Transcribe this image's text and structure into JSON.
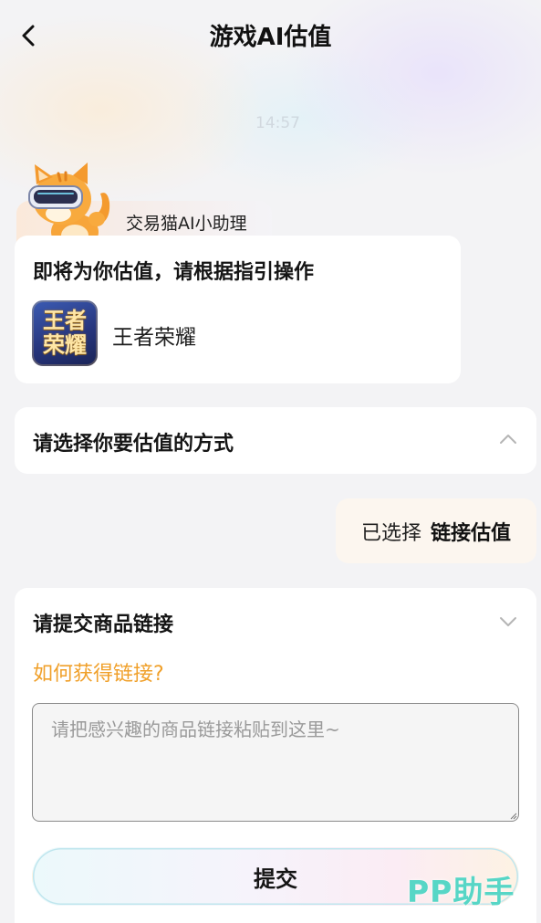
{
  "header": {
    "title": "游戏AI估值",
    "back_icon": "chevron-left-icon"
  },
  "assistant": {
    "name": "交易猫AI小助理",
    "avatar_icon": "cat-mascot-vr-icon"
  },
  "intro_card": {
    "title": "即将为你估值，请根据指引操作",
    "game_icon_line1": "王者",
    "game_icon_line2": "荣耀",
    "game_name": "王者荣耀"
  },
  "method_section": {
    "title": "请选择你要估值的方式",
    "chevron_icon": "chevron-up-icon"
  },
  "selected_reply": {
    "prefix": "已选择",
    "value": "链接估值"
  },
  "link_section": {
    "title": "请提交商品链接",
    "chevron_icon": "chevron-down-icon",
    "help_link": "如何获得链接?",
    "input_placeholder": "请把感兴趣的商品链接粘贴到这里~",
    "input_value": "",
    "submit_label": "提交"
  },
  "watermark": "PP助手",
  "colors": {
    "accent_orange": "#f0a02a",
    "watermark_teal": "#57d6c6",
    "bubble_bg": "#fcf6ef"
  }
}
